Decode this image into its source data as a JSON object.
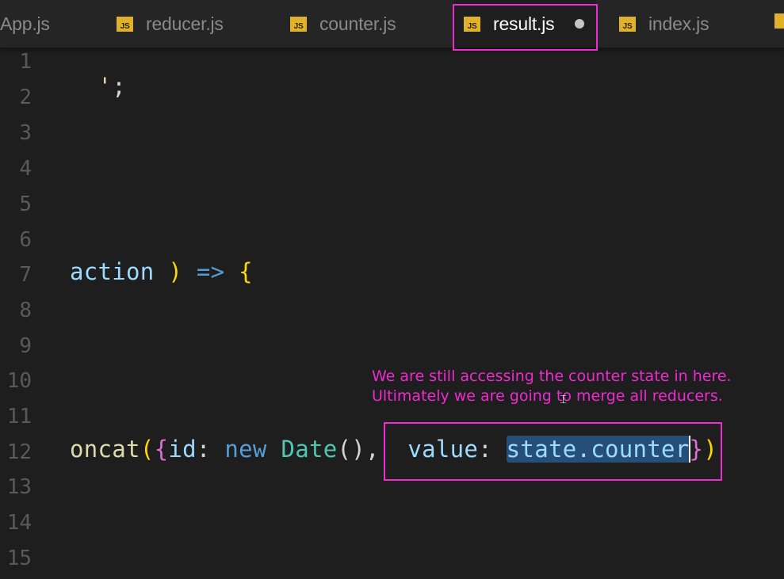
{
  "tabs": [
    {
      "label": "App.js",
      "icon": "js-file-icon",
      "active": false
    },
    {
      "label": "reducer.js",
      "icon": "js-file-icon",
      "active": false
    },
    {
      "label": "counter.js",
      "icon": "js-file-icon",
      "active": false
    },
    {
      "label": "result.js",
      "icon": "js-file-icon",
      "active": true,
      "unsaved": true
    },
    {
      "label": "index.js",
      "icon": "js-file-icon",
      "active": false
    }
  ],
  "js_badge": "JS",
  "line_numbers": [
    "1",
    "2",
    "3",
    "4",
    "5",
    "6",
    "7",
    "8",
    "9",
    "10",
    "11",
    "12",
    "13",
    "14",
    "15"
  ],
  "code": {
    "line1": [
      "'",
      ";"
    ],
    "line7": [
      "action",
      " ",
      ")",
      " ",
      "=>",
      " ",
      "{"
    ],
    "line12": {
      "fn": "oncat",
      "open_paren": "(",
      "open_brace": "{",
      "key_id": "id",
      "colon1": ":",
      "kw_new": "new",
      "cls_date": "Date",
      "call_parens": "()",
      "comma": ",",
      "key_value": "value",
      "colon2": ":",
      "selected": "state.counter",
      "close_brace": "}",
      "close_paren": ")"
    }
  },
  "annotation": {
    "line1": "We are still accessing the counter state in here.",
    "line2": "Ultimately we are going to merge all reducers."
  },
  "colors": {
    "highlight": "#ee2bd0",
    "editor_bg": "#1e1e1e",
    "selection": "#264f78",
    "js_icon": "#e0b12a"
  }
}
